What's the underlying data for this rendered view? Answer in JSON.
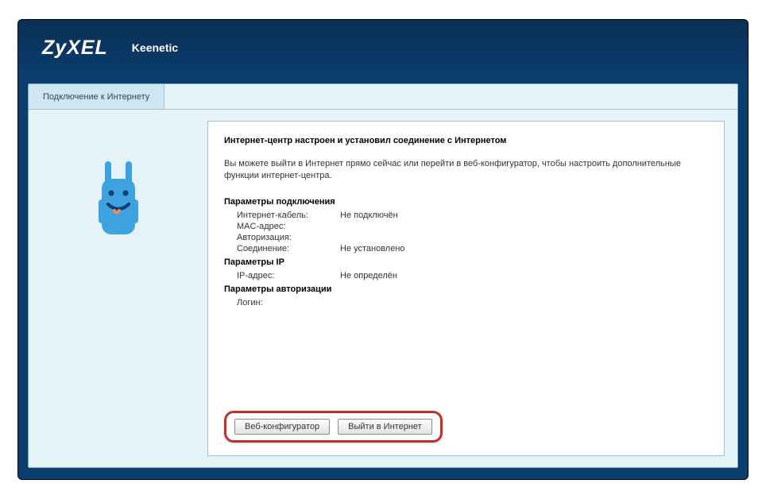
{
  "header": {
    "brand": "ZyXEL",
    "product": "Keenetic"
  },
  "tab": {
    "label": "Подключение к Интернету"
  },
  "content": {
    "title": "Интернет-центр настроен и установил соединение с Интернетом",
    "intro": "Вы можете выйти в Интернет прямо сейчас или перейти в веб-конфигуратор, чтобы настроить дополнительные функции интернет-центра.",
    "section_connection": "Параметры подключения",
    "conn": {
      "cable_label": "Интернет-кабель:",
      "cable_value": "Не подключён",
      "mac_label": "MAC-адрес:",
      "mac_value": "",
      "auth_label": "Авторизация:",
      "auth_value": "",
      "link_label": "Соединение:",
      "link_value": "Не установлено"
    },
    "section_ip": "Параметры IP",
    "ip": {
      "addr_label": "IP-адрес:",
      "addr_value": "Не определён"
    },
    "section_auth": "Параметры авторизации",
    "authp": {
      "login_label": "Логин:",
      "login_value": ""
    }
  },
  "buttons": {
    "configurator": "Веб-конфигуратор",
    "go_internet": "Выйти в Интернет"
  }
}
